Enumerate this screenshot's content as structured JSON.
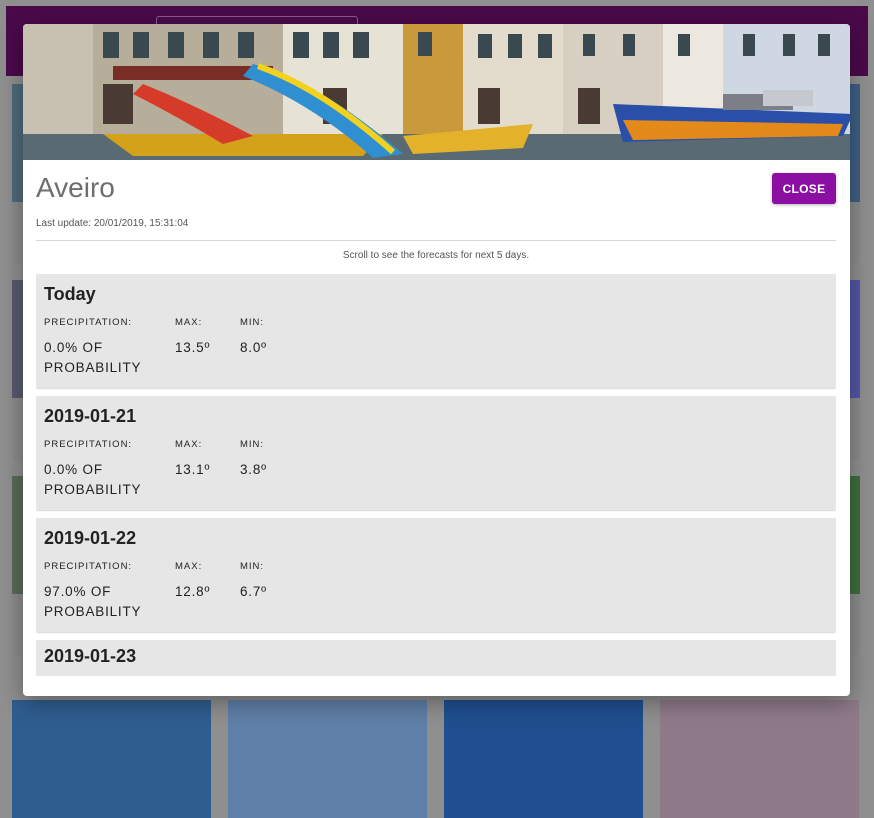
{
  "modal": {
    "city": "Aveiro",
    "close_label": "CLOSE",
    "last_update": "Last update: 20/01/2019, 15:31:04",
    "scroll_hint": "Scroll to see the forecasts for next 5 days.",
    "labels": {
      "precipitation": "PRECIPITATION:",
      "max": "MAX:",
      "min": "MIN:"
    },
    "forecasts": [
      {
        "date": "Today",
        "precip_pct": "0.0% OF",
        "precip_word": "PROBABILITY",
        "max": "13.5º",
        "min": "8.0º"
      },
      {
        "date": "2019-01-21",
        "precip_pct": "0.0% OF",
        "precip_word": "PROBABILITY",
        "max": "13.1º",
        "min": "3.8º"
      },
      {
        "date": "2019-01-22",
        "precip_pct": "97.0% OF",
        "precip_word": "PROBABILITY",
        "max": "12.8º",
        "min": "6.7º"
      },
      {
        "date": "2019-01-23",
        "precip_pct": "",
        "precip_word": "",
        "max": "",
        "min": ""
      }
    ]
  },
  "colors": {
    "accent": "#8b0fa3",
    "topbar": "#4a0a4a",
    "card_bg": "#e6e6e6"
  }
}
